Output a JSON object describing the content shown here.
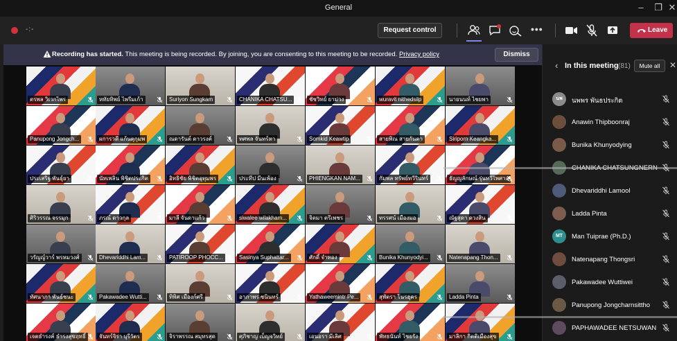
{
  "window": {
    "title": "General",
    "controls": [
      "–",
      "❐",
      "✕"
    ]
  },
  "toolbar": {
    "timer": "-:-",
    "request_control": "Request control",
    "leave": "Leave",
    "more": "•••"
  },
  "banner": {
    "bold": "Recording has started.",
    "text": " This meeting is being recorded. By joining, you are consenting to this meeting to be recorded. ",
    "link": "Privacy policy",
    "dismiss": "Dismiss"
  },
  "panel": {
    "title": "In this meeting",
    "count": "(81)",
    "mute_all": "Mute all",
    "participants": [
      {
        "name": "นพพร พันธประกิต",
        "initials": "นพ",
        "color": "#8a8a8a"
      },
      {
        "name": "Anawin Thipboonraj",
        "initials": "",
        "color": "#6b4f3c"
      },
      {
        "name": "Bunika Khunyodying",
        "initials": "",
        "color": "#7a5b4a"
      },
      {
        "name": "CHANIKA CHATSUNGNERN",
        "initials": "",
        "color": "#556b5a"
      },
      {
        "name": "Dhevariddhi Lamool",
        "initials": "",
        "color": "#4e5a7a"
      },
      {
        "name": "Ladda Pinta",
        "initials": "",
        "color": "#7c5c4c"
      },
      {
        "name": "Man Tuiprae (Ph.D.)",
        "initials": "MT",
        "color": "#2f8f8f"
      },
      {
        "name": "Natenapang Thongsri",
        "initials": "",
        "color": "#6e4c3e"
      },
      {
        "name": "Pakawadee Wuttiwei",
        "initials": "",
        "color": "#5b5f6b"
      },
      {
        "name": "Panupong Jongcharnsittho",
        "initials": "",
        "color": "#6b5845"
      },
      {
        "name": "PAPHAWADEE NETSUWAN",
        "initials": "",
        "color": "#5e4b5f"
      }
    ]
  },
  "tiles": [
    "ดรพล วิเวกไพร",
    "หทัยทิพย์ ไพรีมเก้า",
    "Suriyon Sungkam",
    "CHANIKA CHATSU...",
    "ชัชวิทย์ ยาม่วง",
    "wuravit nithedsilp",
    "นายนนท์ ไชยพา",
    "Panupong Jongch...",
    "ผการวดี แก้นตุกุมพ",
    "ณดารันต์ ดาวรงค์",
    "ทศพล จันทร์หา",
    "Somkid Keawtip",
    "สายพิณ สายกันตา",
    "Siriporn Keangka...",
    "ประเสริฐ พันธุ์ยา",
    "นัทเพลิน พิชิตประกิต",
    "อิทธิชัย พิชิตอุทุมพร",
    "ประทีป มีนเพ้อง",
    "PHIENGKAN NAM...",
    "กัมพล ทรัพย์ทวีรินทร์",
    "ธัญญลักษณ์ รุ่นทวีไพศาล",
    "ศิริวรรณ จรรมุก",
    "ภรณ์ ดาวกุล",
    "มาลี จันดาแก้ว",
    "siwalee wilakham...",
    "จิตมา ตรีเพชร",
    "ทรรศน์ เมืองมอ",
    "ณัฐสุดา ดวงสิน",
    "วรัญญ์วาร์ พรหมวงศ์",
    "Dhevariddhi Lam...",
    "PATIROOP PHOCC...",
    "Sasinya Suphattar...",
    "ศักดิ์ จำทอง",
    "Bunika Khunyodyi...",
    "Natenapang Thon...",
    "ทัศนาภา พันธ์ชนะ",
    "Pakawadee Wutti...",
    "ทิพิศ เมืองก์ศรี",
    "อาภาพร ชนินทร์",
    "Yathaweemintr Pe...",
    "สุพัตรา โนรฮุคร",
    "Ladda Pinta",
    "เจตธำรงค์ ธำรงสุขฤทธิ์",
    "จันทร์จิรา บุรีวัตร",
    "จิราพรรณ สมุทรสุด",
    "ศุภิชาญ เบ็ญจวิทย์",
    "เอนอรา มีเลิศ",
    "พัทธนันท์ ไชยรัง",
    "มาลิกา กิตติเมืองสุข"
  ]
}
